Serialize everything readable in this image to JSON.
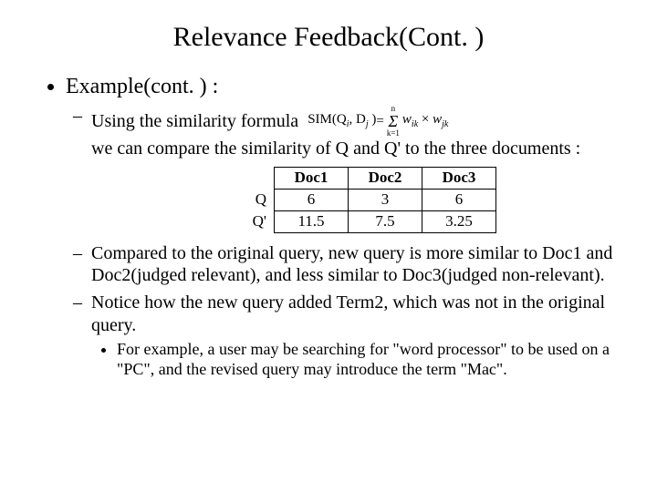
{
  "title": "Relevance Feedback(Cont. )",
  "bullet_l1": "Example(cont. ) :",
  "b2": {
    "item1_line1": "Using the similarity formula",
    "item1_line2": "we can compare the similarity of Q and Q' to the three documents :",
    "item2": "Compared to the original query, new query is more similar to Doc1 and Doc2(judged relevant), and less similar to Doc3(judged non-relevant).",
    "item3": "Notice how the new query added Term2, which was not in the original query."
  },
  "b3": {
    "item1": "For example, a user may be searching for \"word processor\" to be used on a \"PC\", and the revised query may introduce the term \"Mac\"."
  },
  "formula": {
    "sim_text": "SIM(Q",
    "sub_i": "i",
    "comma": ", D",
    "sub_j": "j",
    "close": " )",
    "equals": " = ",
    "sum_top": "n",
    "sum_sym": "Σ",
    "sum_bot": "k=1",
    "w1": "w",
    "w1sub": "ik",
    "times": " × ",
    "w2": "w",
    "w2sub": "jk"
  },
  "table": {
    "headers": [
      "Doc1",
      "Doc2",
      "Doc3"
    ],
    "rows": [
      {
        "label": "Q",
        "cells": [
          "6",
          "3",
          "6"
        ]
      },
      {
        "label": "Q'",
        "cells": [
          "11.5",
          "7.5",
          "3.25"
        ]
      }
    ]
  },
  "chart_data": {
    "type": "table",
    "title": "Similarity of Q and Q' to documents",
    "columns": [
      "Doc1",
      "Doc2",
      "Doc3"
    ],
    "rows": [
      {
        "label": "Q",
        "values": [
          6,
          3,
          6
        ]
      },
      {
        "label": "Q'",
        "values": [
          11.5,
          7.5,
          3.25
        ]
      }
    ]
  }
}
